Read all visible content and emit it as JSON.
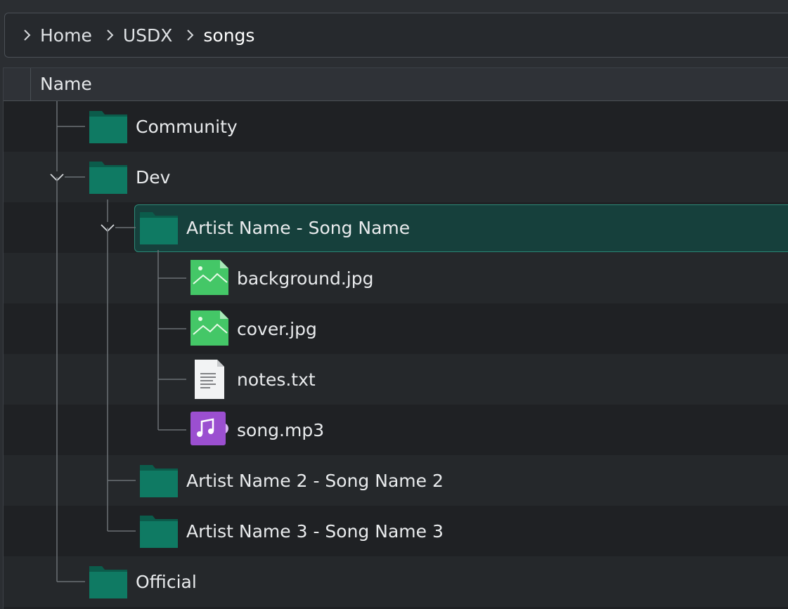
{
  "breadcrumb": [
    {
      "label": "Home"
    },
    {
      "label": "USDX"
    },
    {
      "label": "songs"
    }
  ],
  "tree": {
    "columns": [
      {
        "label": "Name"
      }
    ],
    "rows": [
      {
        "label": "Community",
        "type": "folder",
        "depth": 0,
        "expanded": false,
        "selected": false
      },
      {
        "label": "Dev",
        "type": "folder",
        "depth": 0,
        "expanded": true,
        "selected": false
      },
      {
        "label": "Artist Name - Song Name",
        "type": "folder",
        "depth": 1,
        "expanded": true,
        "selected": true
      },
      {
        "label": "background.jpg",
        "type": "image",
        "depth": 2,
        "selected": false
      },
      {
        "label": "cover.jpg",
        "type": "image",
        "depth": 2,
        "selected": false
      },
      {
        "label": "notes.txt",
        "type": "text",
        "depth": 2,
        "selected": false
      },
      {
        "label": "song.mp3",
        "type": "audio",
        "depth": 2,
        "selected": false
      },
      {
        "label": "Artist Name 2 - Song Name 2",
        "type": "folder",
        "depth": 1,
        "expanded": false,
        "selected": false
      },
      {
        "label": "Artist Name 3 - Song Name 3",
        "type": "folder",
        "depth": 1,
        "expanded": false,
        "selected": false
      },
      {
        "label": "Official",
        "type": "folder",
        "depth": 0,
        "expanded": false,
        "selected": false
      }
    ]
  },
  "colors": {
    "folder": "#0f7a63",
    "folder_tab": "#0b5c4b",
    "image_icon": "#44c767",
    "audio_icon": "#9b4fd0",
    "selection": "#16403c",
    "selection_border": "#2d8a78",
    "tree_lines": "#6b7075"
  },
  "icons": {
    "folder": "folder-icon",
    "image": "image-file-icon",
    "text": "text-file-icon",
    "audio": "audio-file-icon",
    "expand": "chevron-down-icon",
    "breadcrumb_sep": "chevron-right-icon"
  }
}
